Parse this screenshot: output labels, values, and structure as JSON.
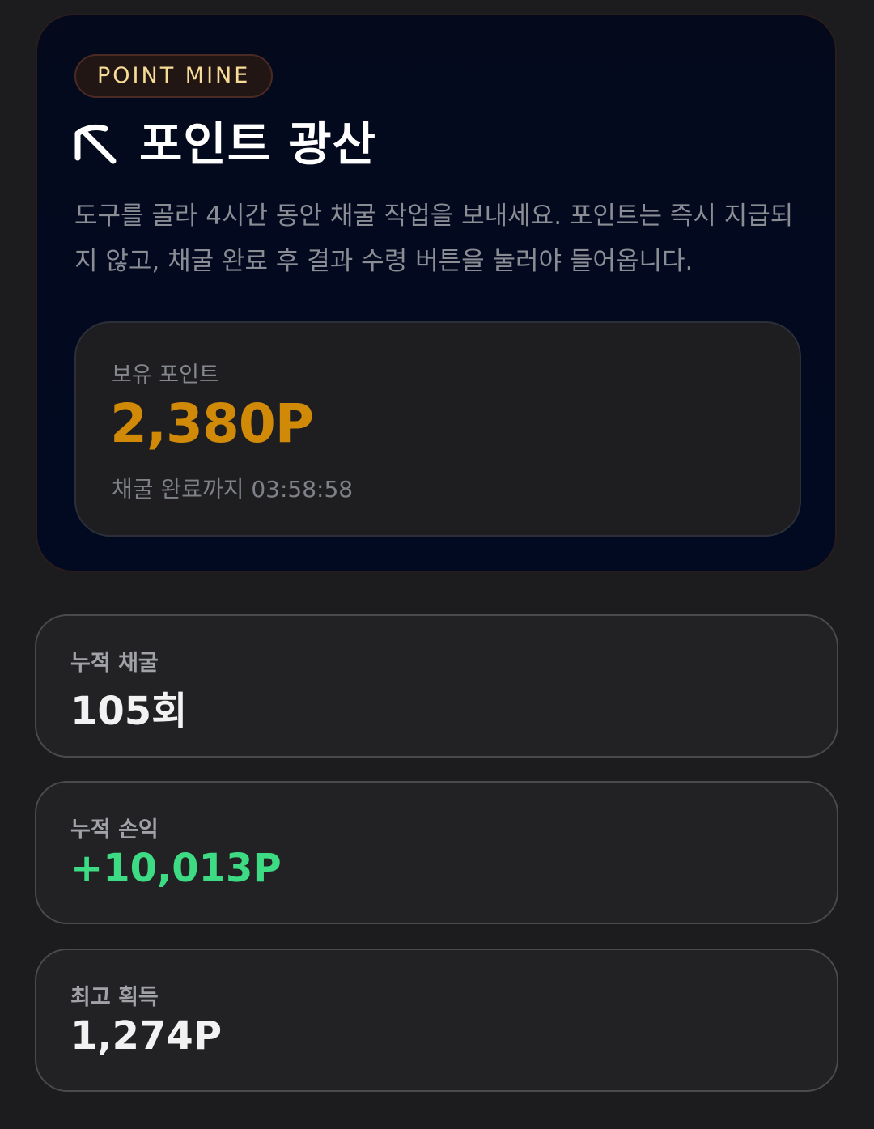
{
  "hero": {
    "badge": "POINT MINE",
    "icon": "pickaxe-icon",
    "title": "포인트 광산",
    "description": "도구를 골라 4시간 동안 채굴 작업을 보내세요. 포인트는 즉시 지급되지 않고, 채굴 완료 후 결과 수령 버튼을 눌러야 들어옵니다."
  },
  "balance": {
    "label": "보유 포인트",
    "value": "2,380P",
    "countdown": "채굴 완료까지 03:58:58"
  },
  "stats": [
    {
      "label": "누적 채굴",
      "value": "105회"
    },
    {
      "label": "누적 손익",
      "value": "+10,013P"
    },
    {
      "label": "최고 획득",
      "value": "1,274P"
    }
  ],
  "colors": {
    "accent_gold": "#d18a08",
    "badge_text": "#f6dc96",
    "positive_green": "#3ddc84",
    "background": "#1c1c1e",
    "hero_background": "#030a1f"
  }
}
